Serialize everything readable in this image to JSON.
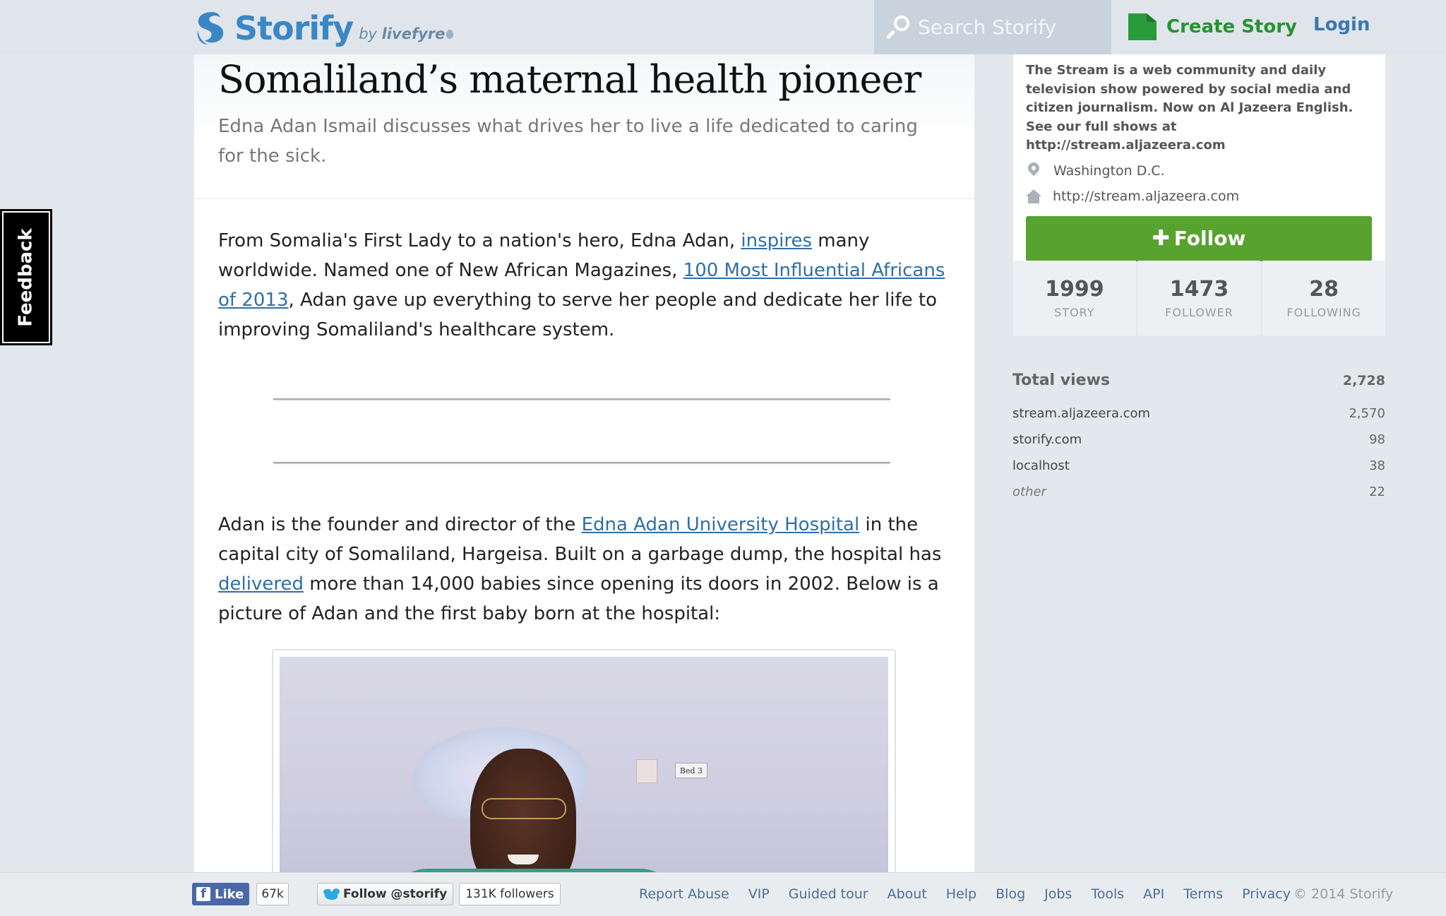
{
  "header": {
    "brand": "Storify",
    "by_prefix": "by",
    "by_brand": "livefyre",
    "search_placeholder": "Search Storify",
    "create_story": "Create Story",
    "login": "Login",
    "brand_color": "#3b87c6",
    "create_color": "#27922f"
  },
  "feedback": {
    "label": "Feedback"
  },
  "story": {
    "title": "Somaliland’s maternal health pioneer",
    "subtitle": "Edna Adan Ismail discusses what drives her to live a life dedicated to caring for the sick.",
    "p1": {
      "t1": "From Somalia's First Lady to a nation's hero, Edna Adan, ",
      "link1": "inspires",
      "t2": " many worldwide. Named one of New African Magazines, ",
      "link2": "100 Most Influential Africans of 2013",
      "t3": ", Adan gave up everything to serve her people and dedicate her life to improving Somaliland's healthcare system."
    },
    "p2": {
      "t1": "Adan is the founder and director of the ",
      "link1": "Edna Adan University Hospital",
      "t2": " in the capital city of Somaliland, Hargeisa. Built on a garbage dump, the hospital has ",
      "link2": "delivered",
      "t3": " more than 14,000 babies since opening its doors in 2002.  Below is a picture of Adan and the first baby born at the hospital:"
    },
    "photo_sign": "Bed 3"
  },
  "profile": {
    "description": "The Stream is a web community and daily television show powered by social media and citizen journalism. Now on Al Jazeera English. See our full shows at http://stream.aljazeera.com",
    "location": "Washington D.C.",
    "website": "http://stream.aljazeera.com",
    "follow_label": "Follow",
    "follow_color": "#58a22f",
    "stats": [
      {
        "num": "1999",
        "label": "STORY"
      },
      {
        "num": "1473",
        "label": "FOLLOWER"
      },
      {
        "num": "28",
        "label": "FOLLOWING"
      }
    ]
  },
  "views": {
    "title": "Total views",
    "total": "2,728",
    "rows": [
      {
        "k": "stream.aljazeera.com",
        "v": "2,570"
      },
      {
        "k": "storify.com",
        "v": "98"
      },
      {
        "k": "localhost",
        "v": "38"
      },
      {
        "k": "other",
        "v": "22"
      }
    ]
  },
  "footer": {
    "fb_like": "Like",
    "fb_count": "67k",
    "tw_follow": "Follow @storify",
    "tw_count": "131K followers",
    "links": [
      "Report Abuse",
      "VIP",
      "Guided tour",
      "About",
      "Help",
      "Blog",
      "Jobs",
      "Tools",
      "API",
      "Terms",
      "Privacy"
    ],
    "copyright": "© 2014 Storify"
  }
}
